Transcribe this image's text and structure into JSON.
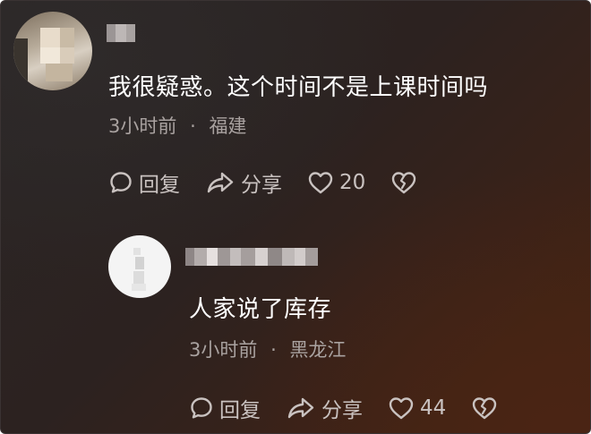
{
  "comments": [
    {
      "text": "我很疑惑。这个时间不是上课时间吗",
      "time": "3小时前",
      "separator": "·",
      "location": "福建",
      "reply_label": "回复",
      "share_label": "分享",
      "like_count": "20"
    },
    {
      "text": "人家说了库存",
      "time": "3小时前",
      "separator": "·",
      "location": "黑龙江",
      "reply_label": "回复",
      "share_label": "分享",
      "like_count": "44"
    }
  ],
  "icons": {
    "reply": "speech-bubble-icon",
    "share": "share-arrow-icon",
    "like": "heart-icon",
    "dislike": "broken-heart-icon"
  },
  "colors": {
    "text": "#ffffff",
    "meta": "#a9a2a0",
    "actions": "#c9c2c0"
  }
}
